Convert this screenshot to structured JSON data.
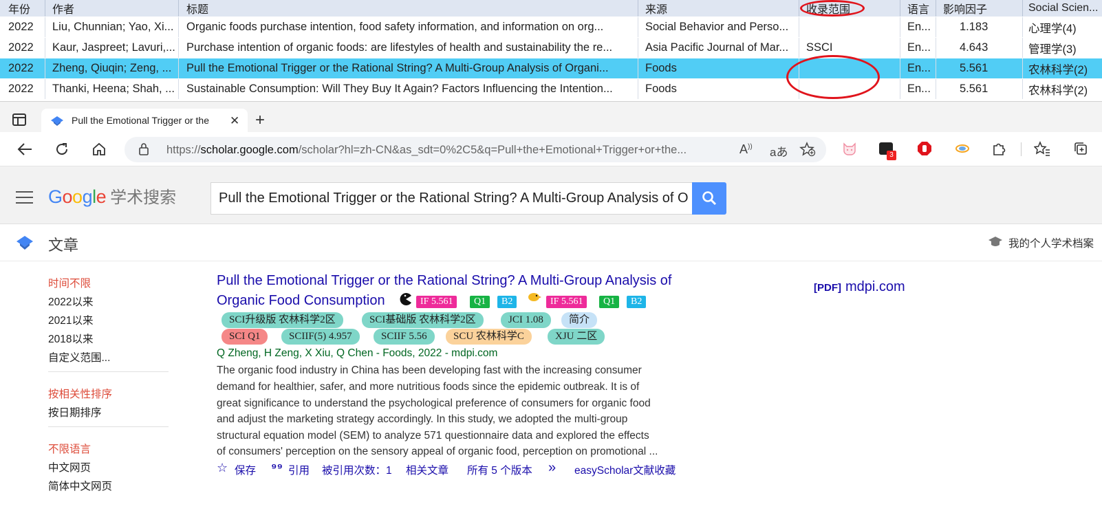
{
  "ref_table": {
    "headers": [
      "年份",
      "作者",
      "标题",
      "来源",
      "收录范围",
      "语言",
      "影响因子",
      "Social Scien..."
    ],
    "rows": [
      {
        "year": "2022",
        "author": "Liu, Chunnian; Yao, Xi...",
        "title": "Organic foods purchase intention, food safety information, and information on org...",
        "source": "Social Behavior and Perso...",
        "range": "",
        "lang": "En...",
        "impact": "1.183",
        "ssci": "心理学(4)"
      },
      {
        "year": "2022",
        "author": "Kaur, Jaspreet; Lavuri,...",
        "title": "Purchase intention of organic foods: are lifestyles of health and sustainability the re...",
        "source": "Asia Pacific Journal of Mar...",
        "range": "SSCI",
        "lang": "En...",
        "impact": "4.643",
        "ssci": "管理学(3)"
      },
      {
        "year": "2022",
        "author": "Zheng, Qiuqin; Zeng, ...",
        "title": "Pull the Emotional Trigger or the Rational String? A Multi-Group Analysis of Organi...",
        "source": "Foods",
        "range": "",
        "lang": "En...",
        "impact": "5.561",
        "ssci": "农林科学(2)"
      },
      {
        "year": "2022",
        "author": "Thanki, Heena; Shah, ...",
        "title": "Sustainable Consumption: Will They Buy It Again? Factors Influencing the Intention...",
        "source": "Foods",
        "range": "",
        "lang": "En...",
        "impact": "5.561",
        "ssci": "农林科学(2)"
      }
    ],
    "selected_row": 2,
    "selected_color": "#51cdf5",
    "annotation_color": "#e0141c"
  },
  "browser": {
    "tab_title": "Pull the Emotional Trigger or the",
    "url_prefix": "https://",
    "url_host": "scholar.google.com",
    "url_rest": "/scholar?hl=zh-CN&as_sdt=0%2C5&q=Pull+the+Emotional+Trigger+or+the...",
    "extension_badge": "3"
  },
  "scholar": {
    "logo_text": "Google",
    "logo_cn": "学术搜索",
    "search_query": "Pull the Emotional Trigger or the Rational String? A Multi-Group Analysis of O",
    "section_label": "文章",
    "profile_link": "我的个人学术档案",
    "time_filters": [
      "时间不限",
      "2022以来",
      "2021以来",
      "2018以来",
      "自定义范围..."
    ],
    "sort_options": [
      "按相关性排序",
      "按日期排序"
    ],
    "language_options": [
      "不限语言",
      "中文网页",
      "简体中文网页"
    ],
    "result": {
      "title_line1": "Pull the Emotional Trigger or the Rational String? A Multi-Group Analysis of",
      "title_line2": "Organic Food Consumption",
      "badges_a": [
        "IF 5.561",
        "Q1",
        "B2"
      ],
      "badges_b": [
        "IF 5.561",
        "Q1",
        "B2"
      ],
      "pills_row1": [
        "SCI升级版 农林科学2区",
        "SCI基础版 农林科学2区",
        "JCI 1.08",
        "简介"
      ],
      "pills_row2": [
        "SCI Q1",
        "SCIIF(5) 4.957",
        "SCIIF 5.56",
        "SCU 农林科学C",
        "XJU 二区"
      ],
      "authors_line": "Q Zheng, H Zeng, X Xiu, Q Chen - Foods, 2022 - mdpi.com",
      "snippet_lines": [
        "The organic food industry in China has been developing fast with the increasing consumer",
        "demand for healthier, safer, and more nutritious foods since the epidemic outbreak. It is of",
        "great significance to understand the psychological preference of consumers for organic food",
        "and adjust the marketing strategy accordingly. In this study, we adopted the multi-group",
        "structural equation model (SEM) to analyze 571 questionnaire data and explored the effects",
        "of consumers' perception on the sensory appeal of organic food, perception on promotional ..."
      ],
      "actions": {
        "save": "保存",
        "cite": "引用",
        "cited_by": "被引用次数：1",
        "related": "相关文章",
        "versions": "所有 5 个版本",
        "more": "»",
        "easyscholar": "easyScholar文献收藏"
      },
      "pdf_tag": "[PDF]",
      "pdf_source": "mdpi.com"
    }
  }
}
